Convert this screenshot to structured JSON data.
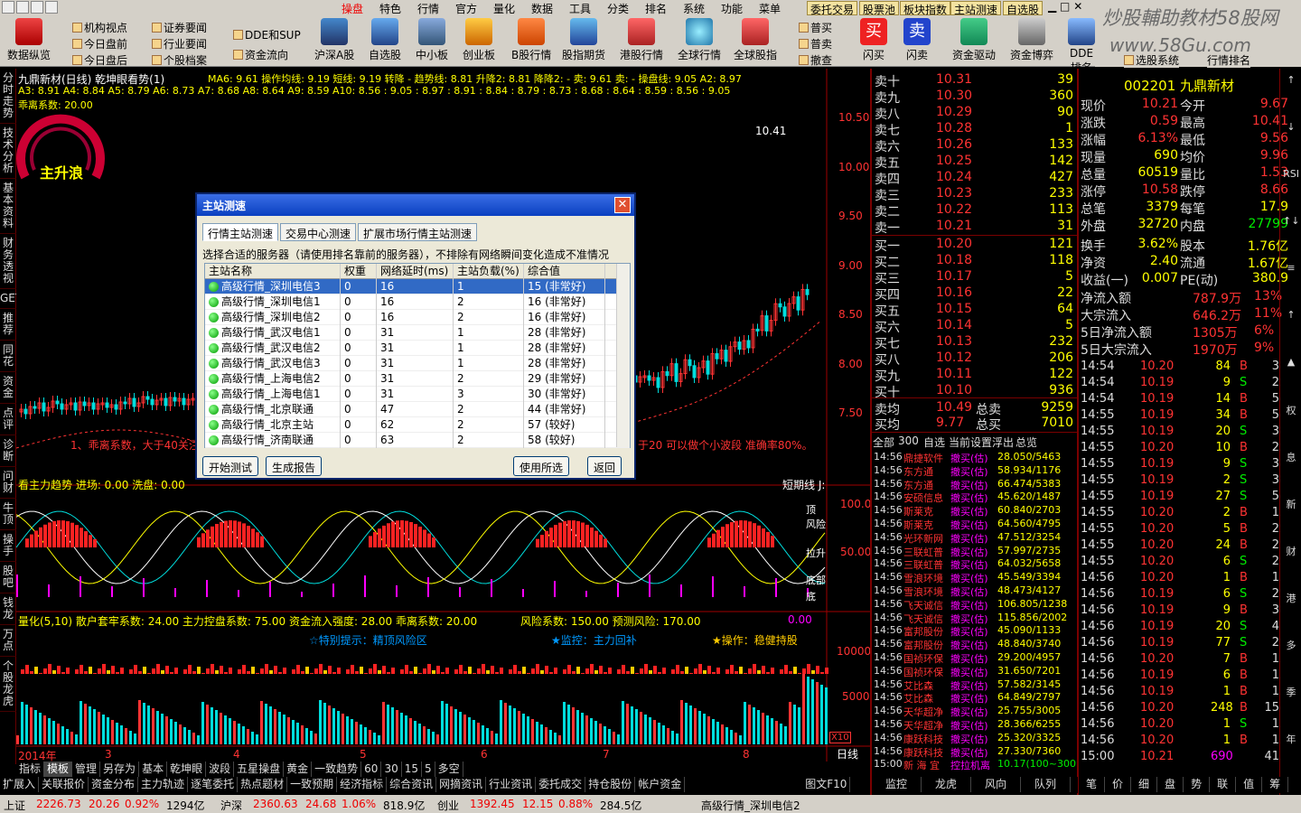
{
  "menu": {
    "items": [
      "操盘",
      "特色",
      "行情",
      "官方",
      "量化",
      "数据",
      "工具",
      "分类",
      "排名",
      "系统",
      "功能",
      "菜单"
    ],
    "buttons": [
      "委托交易",
      "股票池",
      "板块指数",
      "主站测速",
      "自选股"
    ]
  },
  "watermark": {
    "line1": "炒股輔助教材58股网",
    "line2": "www.58Gu.com"
  },
  "toolbar": {
    "small": [
      [
        "机构视点",
        "今日盘前",
        "今日盘后"
      ],
      [
        "证券要闻",
        "行业要闻",
        "个股档案"
      ],
      [
        "DDE和SUP",
        "资金流向"
      ]
    ],
    "big": [
      "数据纵览",
      "沪深A股",
      "自选股",
      "中小板",
      "创业板",
      "B股行情",
      "股指期货",
      "港股行情",
      "全球行情",
      "全球股指",
      "闪买",
      "闪卖",
      "资金驱动",
      "资金博弈",
      "DDE排名",
      "选股系统",
      "行情排名"
    ],
    "mini": [
      "普买",
      "普卖",
      "撤查"
    ]
  },
  "lefttabs": [
    "分时走势",
    "技术分析",
    "基本资料",
    "财务透视",
    "GET",
    "推荐",
    "同花",
    "资金",
    "点评",
    "诊断",
    "问财",
    "牛顶",
    "操手",
    "股吧",
    "钱龙",
    "万点",
    "个股龙虎"
  ],
  "chart": {
    "title": "九鼎新材(日线) 乾坤眼看势(1)",
    "ma_line": "MA6: 9.61  操作均线: 9.19  短线: 9.19  转降 - 趋势线: 8.81  升降2: 8.81  降降2: -  卖: 9.61  卖: -  操盘线: 9.05  A2: 8.97",
    "a_line": "A3: 8.91  A4: 8.84  A5: 8.79  A6: 8.73  A7: 8.68  A8: 8.64  A9: 8.59  A10: 8.56  : 9.05  : 8.97  : 8.91  : 8.84  : 8.79  : 8.73  : 8.68  : 8.64  : 8.59  : 8.56  : 9.05",
    "coef": "乖离系数: 20.00",
    "gauge_label": "主升浪",
    "high_label": "10.41",
    "hint_left": "1、乖离系数，大于40关注",
    "hint_right": "于20 可以做个小波段  准确率80%。",
    "price_axis": [
      "10.50",
      "10.00",
      "9.50",
      "9.00",
      "8.50",
      "8.00",
      "7.50"
    ],
    "mid_title": "看主力趋势  进场: 0.00  洗盘: 0.00",
    "mid_right": "短期线 J:",
    "mid_labels": [
      "顶",
      "风险",
      "拉升",
      "底部",
      "底"
    ],
    "mid_axis": [
      "100.0",
      "50.00"
    ],
    "low_title": "量化(5,10)  散户套牢系数: 24.00  主力控盘系数: 75.00  资金流入强度: 28.00  乖离系数: 20.00",
    "low_title2": "风险系数: 150.00  预测风险: 170.00",
    "low_axis_right": "0.00",
    "low_axis": [
      "10000",
      "5000"
    ],
    "hint1": "☆特别提示：精顶风险区",
    "hint2": "★监控：主力回补",
    "hint3": "★操作：稳健持股",
    "x10": "X10",
    "xaxis": [
      "2014年",
      "3",
      "4",
      "5",
      "6",
      "7",
      "8"
    ],
    "rixian": "日线",
    "chart_period": "日线"
  },
  "dialog": {
    "title": "主站测速",
    "tabs": [
      "行情主站测速",
      "交易中心测速",
      "扩展市场行情主站测速"
    ],
    "instr": "选择合适的服务器（请使用排名靠前的服务器），不排除有网络瞬间变化造成不准情况",
    "columns": [
      "主站名称",
      "权重",
      "网络延时(ms)",
      "主站负载(%)",
      "综合值"
    ],
    "rows": [
      [
        "高级行情_深圳电信3",
        "0",
        "16",
        "1",
        "15 (非常好)"
      ],
      [
        "高级行情_深圳电信1",
        "0",
        "16",
        "2",
        "16 (非常好)"
      ],
      [
        "高级行情_深圳电信2",
        "0",
        "16",
        "2",
        "16 (非常好)"
      ],
      [
        "高级行情_武汉电信1",
        "0",
        "31",
        "1",
        "28 (非常好)"
      ],
      [
        "高级行情_武汉电信2",
        "0",
        "31",
        "1",
        "28 (非常好)"
      ],
      [
        "高级行情_武汉电信3",
        "0",
        "31",
        "1",
        "28 (非常好)"
      ],
      [
        "高级行情_上海电信2",
        "0",
        "31",
        "2",
        "29 (非常好)"
      ],
      [
        "高级行情_上海电信1",
        "0",
        "31",
        "3",
        "30 (非常好)"
      ],
      [
        "高级行情_北京联通",
        "0",
        "47",
        "2",
        "44 (非常好)"
      ],
      [
        "高级行情_北京主站",
        "0",
        "62",
        "2",
        "57 (较好)"
      ],
      [
        "高级行情_济南联通",
        "0",
        "63",
        "2",
        "58 (较好)"
      ]
    ],
    "btn_start": "开始测试",
    "btn_report": "生成报告",
    "btn_use": "使用所选",
    "btn_back": "返回"
  },
  "orderbook": {
    "sell": [
      [
        "卖十",
        "10.31",
        "39"
      ],
      [
        "卖九",
        "10.30",
        "360"
      ],
      [
        "卖八",
        "10.29",
        "90"
      ],
      [
        "卖七",
        "10.28",
        "1"
      ],
      [
        "卖六",
        "10.26",
        "133"
      ],
      [
        "卖五",
        "10.25",
        "142"
      ],
      [
        "卖四",
        "10.24",
        "427"
      ],
      [
        "卖三",
        "10.23",
        "233"
      ],
      [
        "卖二",
        "10.22",
        "113"
      ],
      [
        "卖一",
        "10.21",
        "31"
      ]
    ],
    "buy": [
      [
        "买一",
        "10.20",
        "121"
      ],
      [
        "买二",
        "10.18",
        "118"
      ],
      [
        "买三",
        "10.17",
        "5"
      ],
      [
        "买四",
        "10.16",
        "22"
      ],
      [
        "买五",
        "10.15",
        "64"
      ],
      [
        "买六",
        "10.14",
        "5"
      ],
      [
        "买七",
        "10.13",
        "232"
      ],
      [
        "买八",
        "10.12",
        "206"
      ],
      [
        "买九",
        "10.11",
        "122"
      ],
      [
        "买十",
        "10.10",
        "936"
      ]
    ],
    "avg": [
      [
        "卖均",
        "10.49",
        "总卖",
        "9259"
      ],
      [
        "买均",
        "9.77",
        "总买",
        "7010"
      ]
    ]
  },
  "stock": {
    "code_name": "002201 九鼎新材",
    "rows": [
      [
        "现价",
        "10.21",
        "今开",
        "9.67"
      ],
      [
        "涨跌",
        "0.59",
        "最高",
        "10.41"
      ],
      [
        "涨幅",
        "6.13%",
        "最低",
        "9.56"
      ],
      [
        "现量",
        "690",
        "均价",
        "9.96"
      ],
      [
        "总量",
        "60519",
        "量比",
        "1.53"
      ],
      [
        "涨停",
        "10.58",
        "跌停",
        "8.66"
      ],
      [
        "总笔",
        "3379",
        "每笔",
        "17.9"
      ],
      [
        "外盘",
        "32720",
        "内盘",
        "27799"
      ]
    ],
    "rows2": [
      [
        "换手",
        "3.62%",
        "股本",
        "1.76亿"
      ],
      [
        "净资",
        "2.40",
        "流通",
        "1.67亿"
      ],
      [
        "收益(一)",
        "0.007",
        "PE(动)",
        "380.9"
      ]
    ],
    "flows": [
      [
        "净流入额",
        "787.9万",
        "13%"
      ],
      [
        "大宗流入",
        "646.2万",
        "11%"
      ],
      [
        "5日净流入额",
        "1305万",
        "6%"
      ],
      [
        "5日大宗流入",
        "1970万",
        "9%"
      ]
    ]
  },
  "news_tabs": [
    "全部",
    "300",
    "自选",
    "当前",
    "设置",
    "浮出",
    "总览"
  ],
  "news": [
    [
      "14:56",
      "鼎捷软件",
      "撤买(估)",
      "28.050/5463"
    ],
    [
      "14:56",
      "东方通",
      "撤买(估)",
      "58.934/1176"
    ],
    [
      "14:56",
      "东方通",
      "撤买(估)",
      "66.474/5383"
    ],
    [
      "14:56",
      "安硕信息",
      "撤买(估)",
      "45.620/1487"
    ],
    [
      "14:56",
      "斯莱克",
      "撤买(估)",
      "60.840/2703"
    ],
    [
      "14:56",
      "斯莱克",
      "撤买(估)",
      "64.560/4795"
    ],
    [
      "14:56",
      "光环新网",
      "撤买(估)",
      "47.512/3254"
    ],
    [
      "14:56",
      "三联虹普",
      "撤买(估)",
      "57.997/2735"
    ],
    [
      "14:56",
      "三联虹普",
      "撤买(估)",
      "64.032/5658"
    ],
    [
      "14:56",
      "雪浪环境",
      "撤买(估)",
      "45.549/3394"
    ],
    [
      "14:56",
      "雪浪环境",
      "撤买(估)",
      "48.473/4127"
    ],
    [
      "14:56",
      "飞天诚信",
      "撤买(估)",
      "106.805/1238"
    ],
    [
      "14:56",
      "飞天诚信",
      "撤买(估)",
      "115.856/2002"
    ],
    [
      "14:56",
      "富邦股份",
      "撤买(估)",
      "45.090/1133"
    ],
    [
      "14:56",
      "富邦股份",
      "撤买(估)",
      "48.840/3740"
    ],
    [
      "14:56",
      "国祯环保",
      "撤买(估)",
      "29.200/4957"
    ],
    [
      "14:56",
      "国祯环保",
      "撤买(估)",
      "31.650/7201"
    ],
    [
      "14:56",
      "艾比森",
      "撤买(估)",
      "57.582/3145"
    ],
    [
      "14:56",
      "艾比森",
      "撤买(估)",
      "64.849/2797"
    ],
    [
      "14:56",
      "天华超净",
      "撤买(估)",
      "25.755/3005"
    ],
    [
      "14:56",
      "天华超净",
      "撤买(估)",
      "28.366/6255"
    ],
    [
      "14:56",
      "康跃科技",
      "撤买(估)",
      "25.320/3325"
    ],
    [
      "14:56",
      "康跃科技",
      "撤买(估)",
      "27.330/7360"
    ],
    [
      "15:00",
      "新 海 宜",
      "控拉机离",
      "10.17(100~300"
    ]
  ],
  "ticks": [
    [
      "14:54",
      "10.20",
      "84",
      "B",
      "3"
    ],
    [
      "14:54",
      "10.19",
      "9",
      "S",
      "2"
    ],
    [
      "14:54",
      "10.19",
      "14",
      "B",
      "5"
    ],
    [
      "14:55",
      "10.19",
      "34",
      "B",
      "5"
    ],
    [
      "14:55",
      "10.19",
      "20",
      "S",
      "3"
    ],
    [
      "14:55",
      "10.20",
      "10",
      "B",
      "2"
    ],
    [
      "14:55",
      "10.19",
      "9",
      "S",
      "3"
    ],
    [
      "14:55",
      "10.19",
      "2",
      "S",
      "3"
    ],
    [
      "14:55",
      "10.19",
      "27",
      "S",
      "5"
    ],
    [
      "14:55",
      "10.20",
      "2",
      "B",
      "1"
    ],
    [
      "14:55",
      "10.20",
      "5",
      "B",
      "2"
    ],
    [
      "14:55",
      "10.20",
      "24",
      "B",
      "2"
    ],
    [
      "14:55",
      "10.20",
      "6",
      "S",
      "2"
    ],
    [
      "14:56",
      "10.20",
      "1",
      "B",
      "1"
    ],
    [
      "14:56",
      "10.19",
      "6",
      "S",
      "2"
    ],
    [
      "14:56",
      "10.19",
      "9",
      "B",
      "3"
    ],
    [
      "14:56",
      "10.19",
      "20",
      "S",
      "4"
    ],
    [
      "14:56",
      "10.19",
      "77",
      "S",
      "2"
    ],
    [
      "14:56",
      "10.20",
      "7",
      "B",
      "1"
    ],
    [
      "14:56",
      "10.19",
      "6",
      "B",
      "1"
    ],
    [
      "14:56",
      "10.19",
      "1",
      "B",
      "1"
    ],
    [
      "14:56",
      "10.20",
      "248",
      "B",
      "15"
    ],
    [
      "14:56",
      "10.20",
      "1",
      "S",
      "1"
    ],
    [
      "14:56",
      "10.20",
      "1",
      "B",
      "1"
    ],
    [
      "15:00",
      "10.21",
      "690",
      "",
      "41"
    ]
  ],
  "right_icons": [
    "↑",
    "↓",
    "RSI",
    "↑↓",
    "≡",
    "↑",
    "▲",
    "权",
    "息",
    "新",
    "财",
    "港",
    "多",
    "季",
    "年"
  ],
  "bottom": {
    "tabs1": [
      "指标",
      "模板",
      "管理",
      "另存为",
      "基本",
      "乾坤眼",
      "波段",
      "五星操盘",
      "黄金",
      "一致趋势",
      "60",
      "30",
      "15",
      "5",
      "多空"
    ],
    "tabs2": [
      "扩展入",
      "关联报价",
      "资金分布",
      "主力轨迹",
      "逐笔委托",
      "热点题材",
      "一致预期",
      "经济指标",
      "综合资讯",
      "网摘资讯",
      "行业资讯",
      "委托成交",
      "持仓股份",
      "帐户资金"
    ],
    "extra": [
      "图文F10"
    ],
    "right_tabs": [
      "监控",
      "龙虎",
      "风向",
      "队列"
    ],
    "right_tabs2": [
      "笔",
      "价",
      "细",
      "盘",
      "势",
      "联",
      "值",
      "筹"
    ]
  },
  "status": {
    "items": [
      [
        "上证",
        "2226.73",
        "20.26",
        "0.92%",
        "1294亿"
      ],
      [
        "沪深",
        "2360.63",
        "24.68",
        "1.06%",
        "818.9亿"
      ],
      [
        "创业",
        "1392.45",
        "12.15",
        "0.88%",
        "284.5亿"
      ]
    ],
    "server": "高级行情_深圳电信2"
  },
  "colors": {
    "red": "#ff3030",
    "green": "#00e000",
    "cyan": "#00e0e0",
    "yellow": "#ffff00"
  }
}
